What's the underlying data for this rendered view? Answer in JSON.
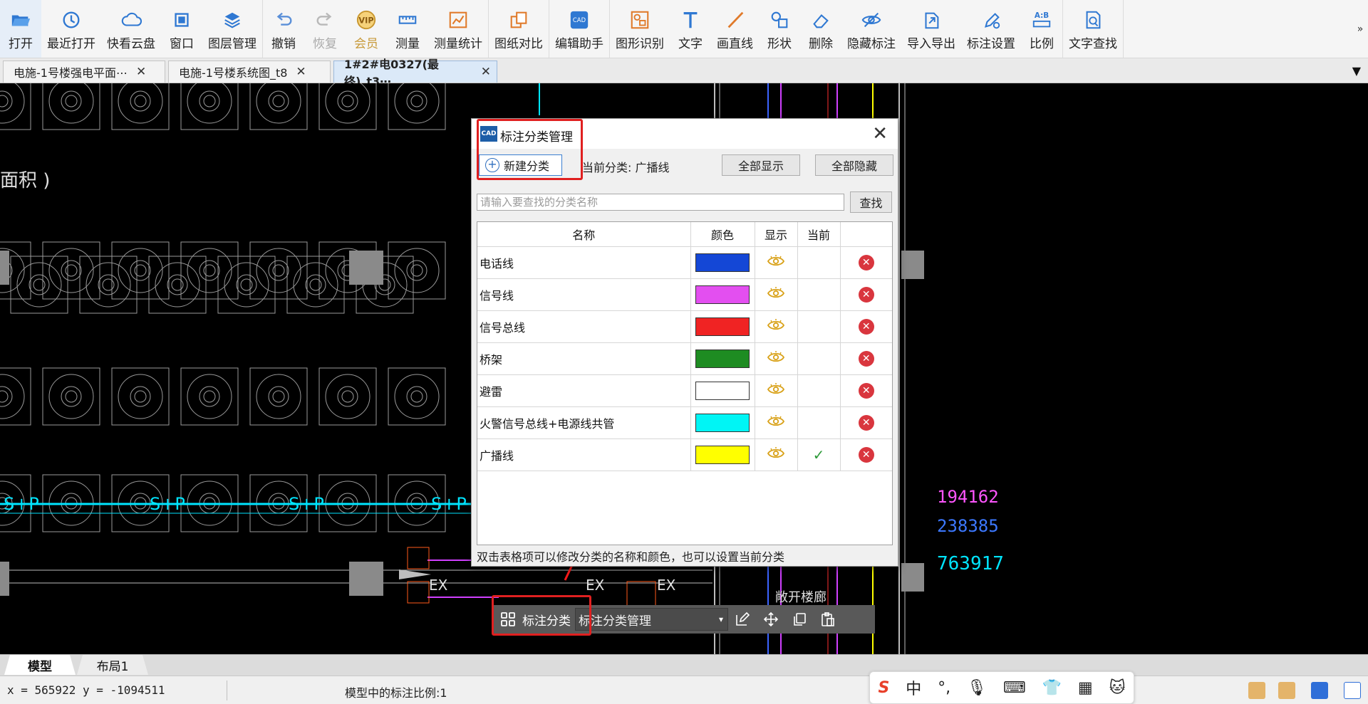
{
  "toolbar": {
    "groups": [
      [
        {
          "label": "打开",
          "icon": "folder-open-icon"
        },
        {
          "label": "最近打开",
          "icon": "history-icon"
        },
        {
          "label": "快看云盘",
          "icon": "cloud-icon"
        },
        {
          "label": "窗口",
          "icon": "window-icon"
        },
        {
          "label": "图层管理",
          "icon": "layers-icon"
        }
      ],
      [
        {
          "label": "撤销",
          "icon": "undo-icon"
        },
        {
          "label": "恢复",
          "icon": "redo-icon",
          "disabled": true
        },
        {
          "label": "会员",
          "icon": "vip-icon",
          "vip": true
        },
        {
          "label": "测量",
          "icon": "ruler-icon"
        },
        {
          "label": "测量统计",
          "icon": "chart-icon"
        }
      ],
      [
        {
          "label": "图纸对比",
          "icon": "compare-icon"
        }
      ],
      [
        {
          "label": "编辑助手",
          "icon": "cad-edit-icon"
        }
      ],
      [
        {
          "label": "图形识别",
          "icon": "shape-recognize-icon"
        },
        {
          "label": "文字",
          "icon": "text-icon"
        },
        {
          "label": "画直线",
          "icon": "line-icon"
        },
        {
          "label": "形状",
          "icon": "shapes-icon"
        },
        {
          "label": "删除",
          "icon": "eraser-icon"
        },
        {
          "label": "隐藏标注",
          "icon": "eye-hide-icon"
        },
        {
          "label": "导入导出",
          "icon": "import-export-icon"
        },
        {
          "label": "标注设置",
          "icon": "annotation-settings-icon"
        },
        {
          "label": "比例",
          "icon": "scale-icon"
        }
      ],
      [
        {
          "label": "文字查找",
          "icon": "text-search-icon"
        }
      ]
    ],
    "more": "»"
  },
  "tabs": [
    {
      "label": "电施-1号楼强电平面⋯",
      "active": false
    },
    {
      "label": "电施-1号楼系统图_t8",
      "active": false
    },
    {
      "label": "1#2#电0327(最终)_t3⋯",
      "active": true
    }
  ],
  "tab_dropdown": "▼",
  "close_glyph": "✕",
  "canvas_text": {
    "mianji": "面积  )",
    "n194": "194162",
    "n238": "238385",
    "n763": "763917",
    "sp": "S+P",
    "ex": "EX",
    "chinese": "敞开楼廊"
  },
  "dialog": {
    "app_icon": "CAD",
    "title": "标注分类管理",
    "close": "✕",
    "new_button": "新建分类",
    "current_category": "当前分类: 广播线",
    "show_all": "全部显示",
    "hide_all": "全部隐藏",
    "search_placeholder": "请输入要查找的分类名称",
    "search_button": "查找",
    "columns": [
      "名称",
      "颜色",
      "显示",
      "当前",
      ""
    ],
    "rows": [
      {
        "name": "电话线",
        "color": "#1447d6",
        "visible": true,
        "current": false
      },
      {
        "name": "信号线",
        "color": "#e34ff0",
        "visible": true,
        "current": false
      },
      {
        "name": "信号总线",
        "color": "#f02323",
        "visible": true,
        "current": false
      },
      {
        "name": "桥架",
        "color": "#1e8c22",
        "visible": true,
        "current": false
      },
      {
        "name": "避雷",
        "color": "#ffffff",
        "visible": true,
        "current": false
      },
      {
        "name": "火警信号总线+电源线共管",
        "color": "#00f5f5",
        "visible": true,
        "current": false
      },
      {
        "name": "广播线",
        "color": "#ffff00",
        "visible": true,
        "current": true
      }
    ],
    "check_glyph": "✓",
    "delete_glyph": "✕",
    "hint": "双击表格项可以修改分类的名称和颜色，也可以设置当前分类"
  },
  "float_bar": {
    "label": "标注分类",
    "select_value": "标注分类管理",
    "arrow": "▾"
  },
  "layout_tabs": {
    "model": "模型",
    "layout1": "布局1"
  },
  "status": {
    "coords": "x = 565922 y = -1094511",
    "scale": "模型中的标注比例:1"
  },
  "ime": {
    "logo": "S",
    "mode": "中",
    "punct": "°,",
    "mic": "🎙",
    "keyboard": "⌨",
    "skin": "👕",
    "grid": "▦",
    "extra": "🐱"
  },
  "colors": {
    "accent_red": "#e02020",
    "dialog_blue": "#3c7fd1"
  }
}
